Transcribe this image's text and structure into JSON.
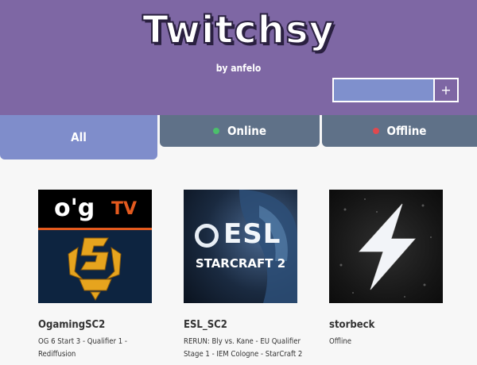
{
  "header": {
    "title": "Twitchsy",
    "byline": "by anfelo",
    "add_input_value": "",
    "add_button_label": "+"
  },
  "tabs": [
    {
      "label": "All",
      "active": true
    },
    {
      "label": "Online",
      "indicator": "green-dot"
    },
    {
      "label": "Offline",
      "indicator": "red-dot"
    }
  ],
  "channels": [
    {
      "name": "OgamingSC2",
      "status_lines": [
        "OG 6 Start 3 - Qualifier 1 - Rediffusion"
      ],
      "logo": "og-tv-starcraft-logo",
      "thumb_text": [
        "o'g",
        "TV"
      ]
    },
    {
      "name": "ESL_SC2",
      "status_lines": [
        "RERUN: Bly vs. Kane - EU Qualifier",
        "Stage 1 - IEM Cologne - StarCraft 2"
      ],
      "logo": "esl-starcraft-2-logo",
      "thumb_text": [
        "ESL",
        "STARCRAFT 2"
      ]
    },
    {
      "name": "storbeck",
      "status_lines": [
        "Offline"
      ],
      "logo": "lightning-bolt-icon"
    }
  ],
  "colors": {
    "header_bg": "#7e67a4",
    "tab_active": "#7f8dcb",
    "tab_inactive": "#5f7188",
    "online": "#4bbf6b",
    "offline": "#e0494e"
  }
}
